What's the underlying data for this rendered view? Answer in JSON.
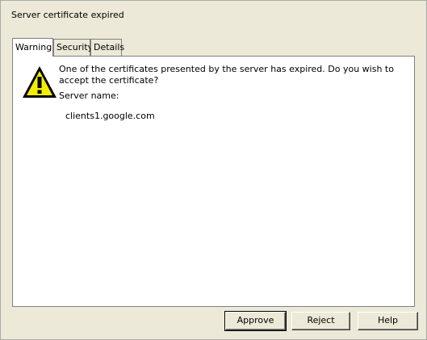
{
  "dialog": {
    "title": "Server certificate expired"
  },
  "tabs": [
    {
      "label": "Warning",
      "active": true
    },
    {
      "label": "Security",
      "active": false
    },
    {
      "label": "Details",
      "active": false
    }
  ],
  "warning": {
    "icon": "warning-triangle-icon",
    "message": "One of the certificates presented by the server has expired. Do you wish to accept the certificate?",
    "server_label": "Server name:",
    "server_name": "clients1.google.com"
  },
  "buttons": {
    "approve": "Approve",
    "reject": "Reject",
    "help": "Help"
  },
  "colors": {
    "dialog_background": "#ece9d8",
    "panel_background": "#ffffff",
    "warning_icon_fill": "#f2ee00"
  }
}
